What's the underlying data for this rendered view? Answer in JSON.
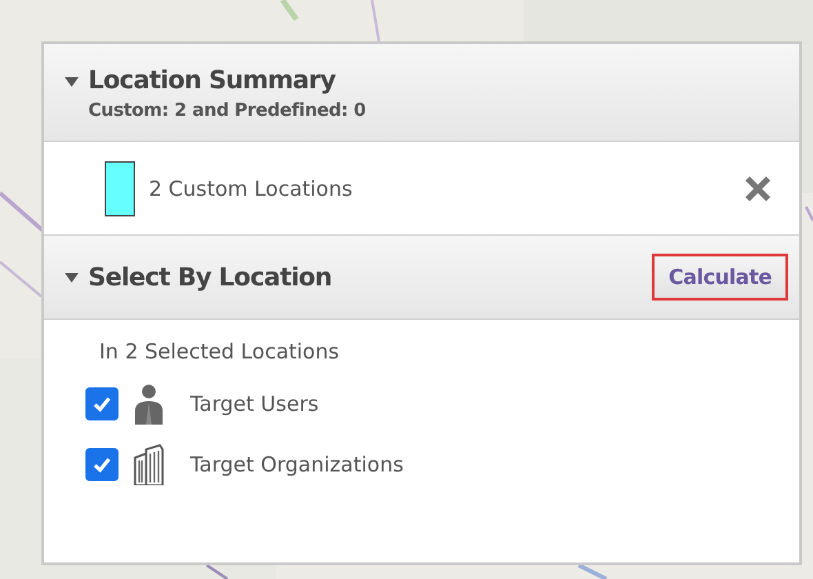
{
  "location_summary": {
    "title": "Location Summary",
    "expanded": true,
    "subtitle": "Custom: 2 and Predefined: 0",
    "locations": [
      {
        "label": "2 Custom Locations",
        "color": "#66ffff"
      }
    ]
  },
  "select_by_location": {
    "title": "Select By Location",
    "expanded": true,
    "calculate_button": {
      "label": "Calculate",
      "highlighted": true
    },
    "caption": "In 2 Selected Locations",
    "targets": [
      {
        "kind": "users",
        "label": "Target Users",
        "checked": true
      },
      {
        "kind": "organizations",
        "label": "Target Organizations",
        "checked": true
      }
    ]
  }
}
